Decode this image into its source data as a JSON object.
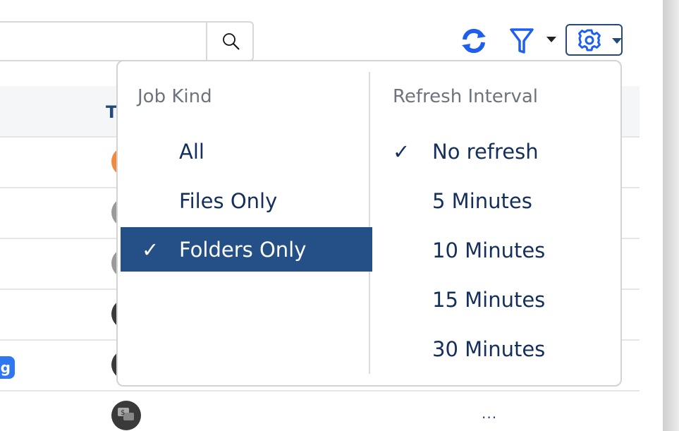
{
  "toolbar": {
    "search": {
      "placeholder": "",
      "icon": "search-icon"
    },
    "refresh_icon": "refresh-icon",
    "filter_icon": "filter-icon",
    "settings_icon": "gear-icon",
    "accent_color": "#1f5ff0"
  },
  "table": {
    "header_partial": "T",
    "badge_partial": "g",
    "more_label": "...",
    "avatars": [
      "orange",
      "gray",
      "gray",
      "dark",
      "dark",
      "chat-dollar"
    ]
  },
  "settings_menu": {
    "job_kind": {
      "title": "Job Kind",
      "items": [
        {
          "label": "All",
          "checked": false
        },
        {
          "label": "Files Only",
          "checked": false
        },
        {
          "label": "Folders Only",
          "checked": true
        }
      ]
    },
    "refresh_interval": {
      "title": "Refresh Interval",
      "items": [
        {
          "label": "No refresh",
          "checked": true
        },
        {
          "label": "5 Minutes",
          "checked": false
        },
        {
          "label": "10 Minutes",
          "checked": false
        },
        {
          "label": "15 Minutes",
          "checked": false
        },
        {
          "label": "30 Minutes",
          "checked": false
        }
      ]
    },
    "check_mark": "✓",
    "selected_color": "#245087"
  }
}
